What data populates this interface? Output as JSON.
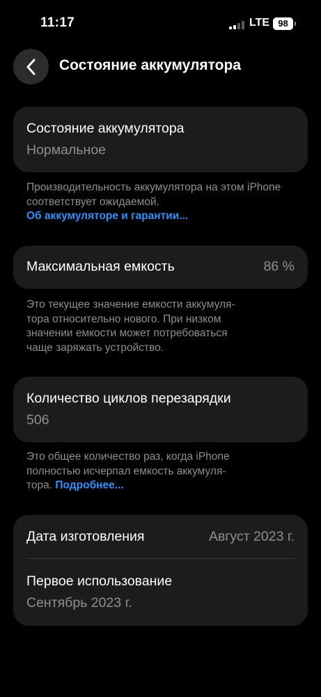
{
  "status_bar": {
    "time": "11:17",
    "network": "LTE",
    "battery": "98"
  },
  "nav": {
    "title": "Состояние аккумулятора",
    "back_icon": "chevron-left-icon"
  },
  "health": {
    "label": "Состояние аккумулятора",
    "value": "Нормальное",
    "footnote": "Производительность аккумулятора на этом iPhone соответствует ожидаемой.",
    "link": "Об аккумуляторе и гарантии..."
  },
  "capacity": {
    "label": "Максимальная емкость",
    "value": "86 %",
    "footnote_lines": [
      "Это текущее значение емкости аккумуля-",
      "тора относительно нового. При низком",
      "значении емкости может потребоваться",
      "чаще заряжать устройство."
    ]
  },
  "cycles": {
    "label": "Количество циклов перезарядки",
    "value": "506",
    "footnote_lines": [
      "Это общее количество раз, когда iPhone",
      "полностью исчерпал емкость аккумуля-"
    ],
    "footnote_last": "тора.",
    "link": "Подробнее..."
  },
  "dates": {
    "manufacture_label": "Дата изготовления",
    "manufacture_value": "Август 2023 г.",
    "first_use_label": "Первое использование",
    "first_use_value": "Сентябрь 2023 г."
  },
  "colors": {
    "background": "#000000",
    "card": "#1c1c1e",
    "secondary_text": "#8e8e93",
    "link": "#3a8ef6"
  }
}
